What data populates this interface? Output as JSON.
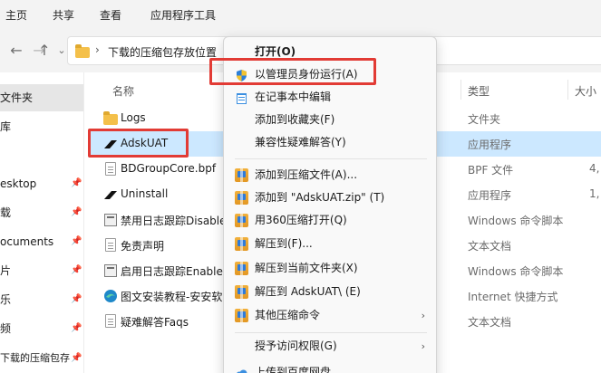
{
  "ribbon": {
    "tabs": [
      "主页",
      "共享",
      "查看",
      "应用程序工具"
    ]
  },
  "address": {
    "path": "下载的压缩包存放位置"
  },
  "nav_pane": {
    "items": [
      {
        "label": "文件夹",
        "selected": true,
        "pinned": false
      },
      {
        "label": "库",
        "selected": false,
        "pinned": false
      },
      {
        "label": "esktop",
        "selected": false,
        "pinned": true
      },
      {
        "label": "载",
        "selected": false,
        "pinned": true
      },
      {
        "label": "ocuments",
        "selected": false,
        "pinned": true
      },
      {
        "label": "片",
        "selected": false,
        "pinned": true
      },
      {
        "label": "乐",
        "selected": false,
        "pinned": true
      },
      {
        "label": "频",
        "selected": false,
        "pinned": true
      },
      {
        "label": "下载的压缩包存",
        "selected": false,
        "pinned": true
      }
    ]
  },
  "columns": {
    "name": "名称",
    "type": "类型",
    "size": "大小"
  },
  "files": [
    {
      "name": "Logs",
      "icon": "folder-icon",
      "type": "文件夹",
      "size": "",
      "selected": false
    },
    {
      "name": "AdskUAT",
      "icon": "app-icon",
      "type": "应用程序",
      "size": "",
      "selected": true
    },
    {
      "name": "BDGroupCore.bpf",
      "icon": "document-icon",
      "type": "BPF 文件",
      "size": "4,",
      "selected": false
    },
    {
      "name": "Uninstall",
      "icon": "app-icon",
      "type": "应用程序",
      "size": "1,",
      "selected": false
    },
    {
      "name": "禁用日志跟踪Disable",
      "icon": "cmd-icon",
      "type": "Windows 命令脚本",
      "size": "",
      "selected": false
    },
    {
      "name": "免责声明",
      "icon": "document-icon",
      "type": "文本文档",
      "size": "",
      "selected": false
    },
    {
      "name": "启用日志跟踪Enable",
      "icon": "cmd-icon",
      "type": "Windows 命令脚本",
      "size": "",
      "selected": false
    },
    {
      "name": "图文安装教程-安安软",
      "icon": "edge-icon",
      "type": "Internet 快捷方式",
      "size": "",
      "selected": false
    },
    {
      "name": "疑难解答Faqs",
      "icon": "document-icon",
      "type": "文本文档",
      "size": "",
      "selected": false
    }
  ],
  "context_menu": {
    "items": [
      {
        "label": "打开(O)",
        "icon": "",
        "bold": true,
        "submenu": false
      },
      {
        "label": "以管理员身份运行(A)",
        "icon": "uac-shield-icon",
        "bold": false,
        "submenu": false
      },
      {
        "label": "在记事本中编辑",
        "icon": "notepad-icon",
        "bold": false,
        "submenu": false
      },
      {
        "label": "添加到收藏夹(F)",
        "icon": "",
        "bold": false,
        "submenu": false
      },
      {
        "label": "兼容性疑难解答(Y)",
        "icon": "",
        "bold": false,
        "submenu": false
      },
      {
        "label": "添加到压缩文件(A)...",
        "icon": "zip-icon",
        "bold": false,
        "submenu": false
      },
      {
        "label": "添加到 \"AdskUAT.zip\" (T)",
        "icon": "zip-icon",
        "bold": false,
        "submenu": false
      },
      {
        "label": "用360压缩打开(Q)",
        "icon": "zip-icon",
        "bold": false,
        "submenu": false
      },
      {
        "label": "解压到(F)...",
        "icon": "zip-icon",
        "bold": false,
        "submenu": false
      },
      {
        "label": "解压到当前文件夹(X)",
        "icon": "zip-icon",
        "bold": false,
        "submenu": false
      },
      {
        "label": "解压到 AdskUAT\\ (E)",
        "icon": "zip-icon",
        "bold": false,
        "submenu": false
      },
      {
        "label": "其他压缩命令",
        "icon": "zip-icon",
        "bold": false,
        "submenu": true
      },
      {
        "label": "授予访问权限(G)",
        "icon": "",
        "bold": false,
        "submenu": true
      },
      {
        "label": "上传到百度网盘",
        "icon": "cloud-icon",
        "bold": false,
        "submenu": false
      }
    ]
  },
  "colors": {
    "highlight": "#e23b35",
    "selection": "#cce8ff",
    "folder": "#f4c04a"
  }
}
